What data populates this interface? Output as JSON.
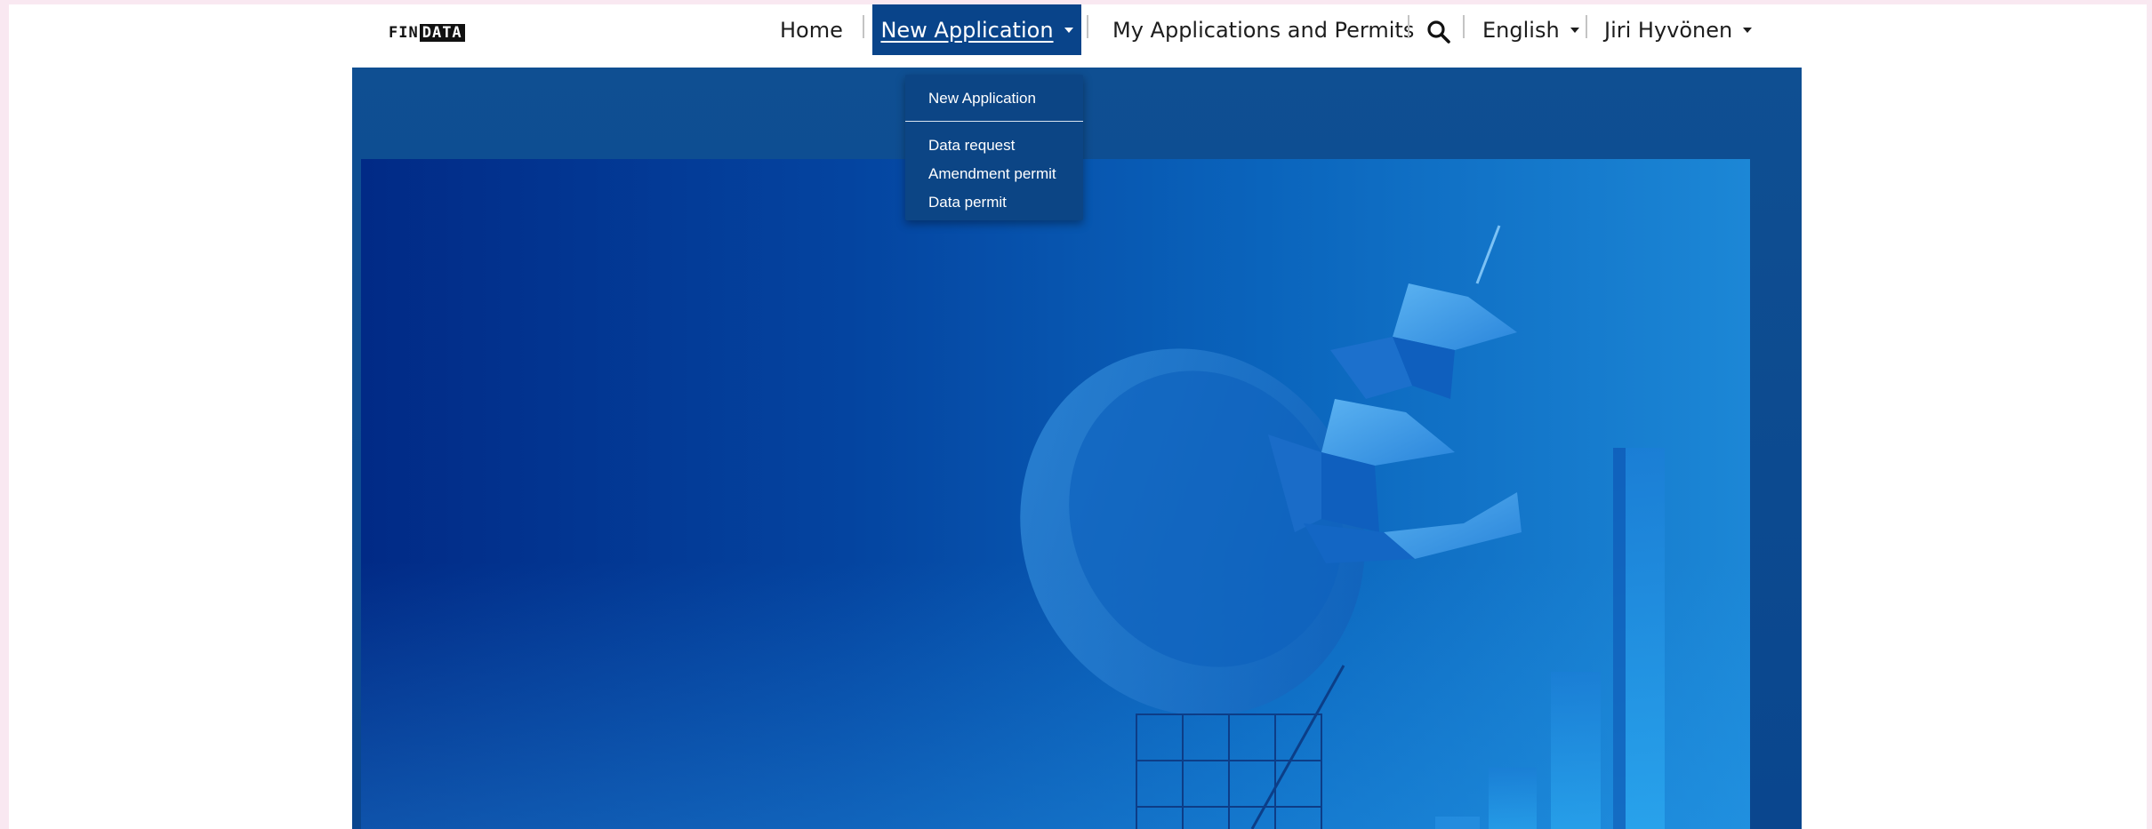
{
  "header": {
    "logo": {
      "part1": "FIN",
      "part2": "DATA"
    },
    "nav": {
      "home": "Home",
      "new_application": "New Application",
      "my_applications": "My Applications and Permits",
      "language": "English",
      "user": "Jiri Hyvönen"
    },
    "icons": {
      "search": "search-icon",
      "caret": "caret-down-icon"
    },
    "colors": {
      "active_nav_bg": "#09448a",
      "text": "#1d1d1d"
    }
  },
  "dropdown": {
    "header": "New Application",
    "items": [
      "Data request",
      "Amendment permit",
      "Data permit"
    ]
  },
  "colors": {
    "page_bg": "#f9e8f1",
    "hero_outer": "#0a468e",
    "hero_inner_left": "#012a86",
    "hero_inner_right": "#1c87d6",
    "dropdown_bg": "#0c4585"
  }
}
